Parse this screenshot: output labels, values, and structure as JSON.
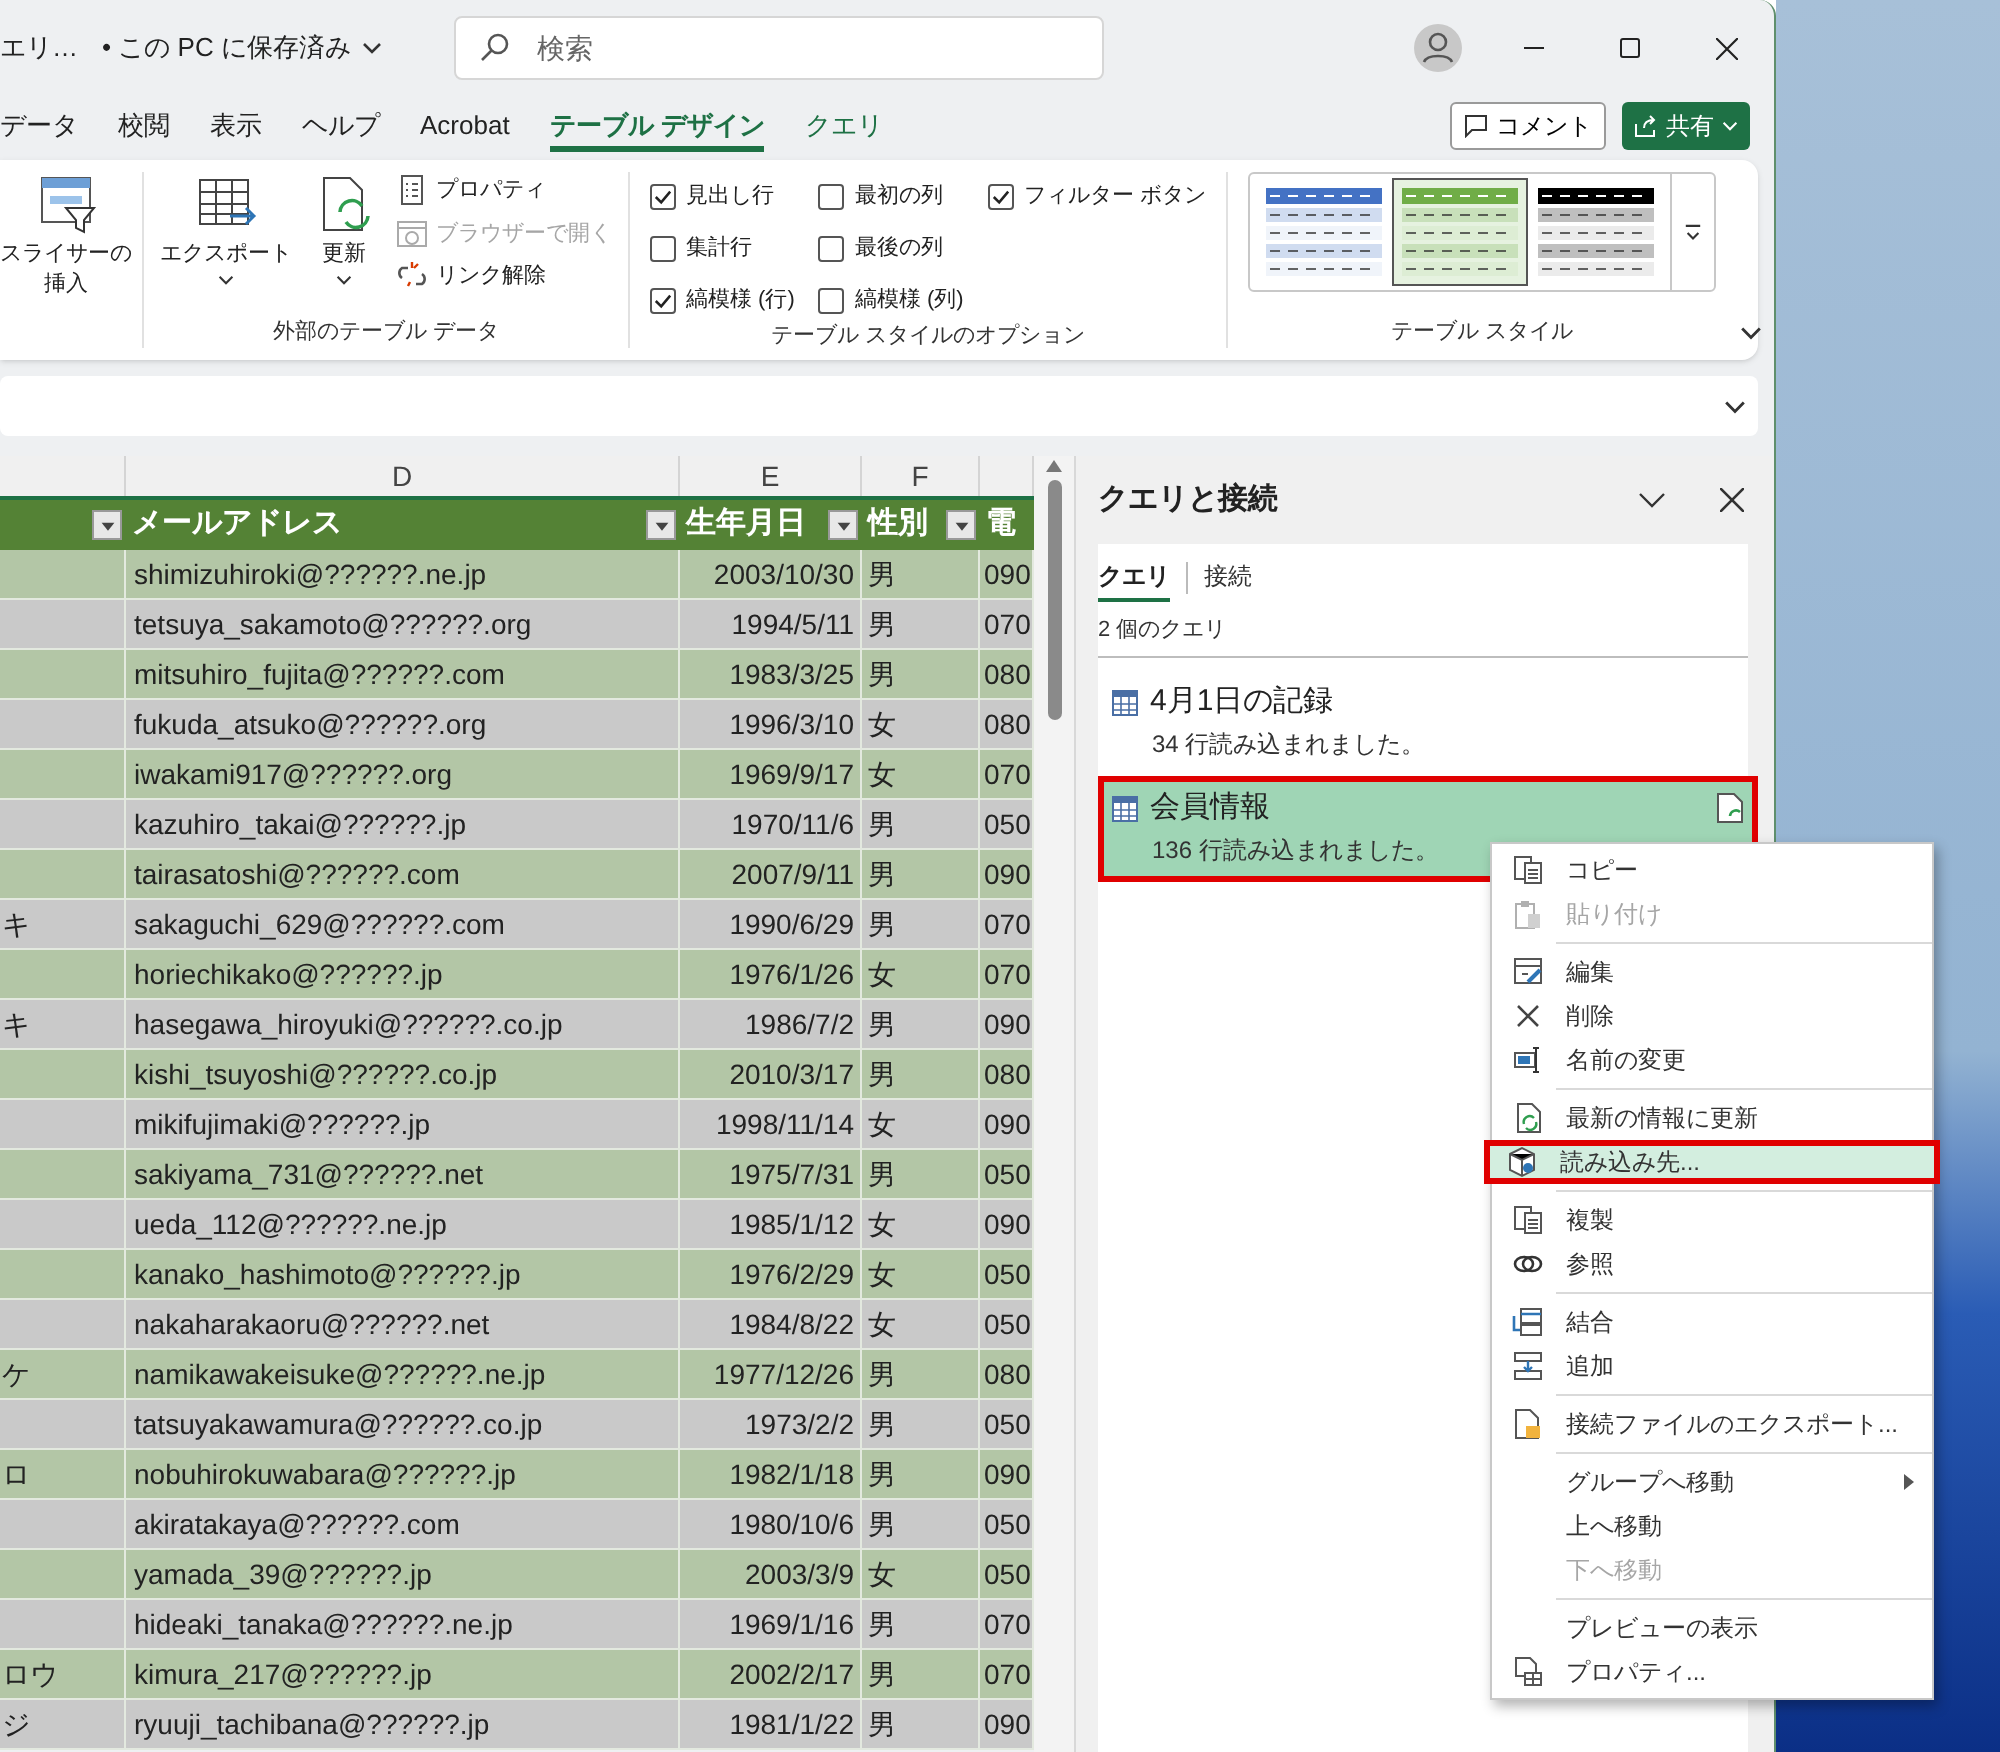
{
  "title_bar": {
    "file_name": "エリ…",
    "save_status": "• この PC に保存済み",
    "search": {
      "placeholder": "検索"
    }
  },
  "ribbon_tabs": [
    {
      "label": "データ",
      "kind": "normal",
      "selected": false
    },
    {
      "label": "校閲",
      "kind": "normal",
      "selected": false
    },
    {
      "label": "表示",
      "kind": "normal",
      "selected": false
    },
    {
      "label": "ヘルプ",
      "kind": "normal",
      "selected": false
    },
    {
      "label": "Acrobat",
      "kind": "normal",
      "selected": false
    },
    {
      "label": "テーブル デザイン",
      "kind": "contextual",
      "selected": true
    },
    {
      "label": "クエリ",
      "kind": "contextual",
      "selected": false
    }
  ],
  "comment_button": "コメント",
  "share_button": "共有",
  "ribbon": {
    "slicer_button": [
      "スライサーの",
      "挿入"
    ],
    "external_data": {
      "title": "外部のテーブル データ",
      "large_buttons": [
        "エクスポート",
        "更新"
      ],
      "small_buttons": [
        {
          "label": "プロパティ",
          "disabled": false
        },
        {
          "label": "ブラウザーで開く",
          "disabled": true
        },
        {
          "label": "リンク解除",
          "disabled": false
        }
      ]
    },
    "style_options": {
      "title": "テーブル スタイルのオプション",
      "checkboxes": [
        {
          "label": "見出し行",
          "checked": true
        },
        {
          "label": "集計行",
          "checked": false
        },
        {
          "label": "縞模様 (行)",
          "checked": true
        },
        {
          "label": "最初の列",
          "checked": false
        },
        {
          "label": "最後の列",
          "checked": false
        },
        {
          "label": "縞模様 (列)",
          "checked": false
        },
        {
          "label": "フィルター ボタン",
          "checked": true
        }
      ]
    },
    "table_styles": {
      "title": "テーブル スタイル",
      "styles": [
        {
          "color": "#4472c4",
          "selected": false
        },
        {
          "color": "#70ad47",
          "selected": true
        },
        {
          "color": "#000000",
          "selected": false
        }
      ]
    }
  },
  "sheet": {
    "columns": [
      {
        "filter_button": true
      },
      {
        "letter": "D",
        "header": "メールアドレス",
        "filter_button": true
      },
      {
        "letter": "E",
        "header": "生年月日",
        "filter_button": true
      },
      {
        "letter": "F",
        "header": "性別",
        "filter_button": true
      },
      {
        "header": "電",
        "filter_button": false
      }
    ],
    "rows": [
      {
        "email": "shimizuhiroki@??????.ne.jp",
        "birthdate": "2003/10/30",
        "gender": "男",
        "phone": "090"
      },
      {
        "email": "tetsuya_sakamoto@??????.org",
        "birthdate": "1994/5/11",
        "gender": "男",
        "phone": "070"
      },
      {
        "email": "mitsuhiro_fujita@??????.com",
        "birthdate": "1983/3/25",
        "gender": "男",
        "phone": "080"
      },
      {
        "email": "fukuda_atsuko@??????.org",
        "birthdate": "1996/3/10",
        "gender": "女",
        "phone": "080"
      },
      {
        "email": "iwakami917@??????.org",
        "birthdate": "1969/9/17",
        "gender": "女",
        "phone": "070"
      },
      {
        "email": "kazuhiro_takai@??????.jp",
        "birthdate": "1970/11/6",
        "gender": "男",
        "phone": "050"
      },
      {
        "email": "tairasatoshi@??????.com",
        "birthdate": "2007/9/11",
        "gender": "男",
        "phone": "090"
      },
      {
        "column_c": "キ",
        "email": "sakaguchi_629@??????.com",
        "birthdate": "1990/6/29",
        "gender": "男",
        "phone": "070"
      },
      {
        "email": "horiechikako@??????.jp",
        "birthdate": "1976/1/26",
        "gender": "女",
        "phone": "070"
      },
      {
        "column_c": "キ",
        "email": "hasegawa_hiroyuki@??????.co.jp",
        "birthdate": "1986/7/2",
        "gender": "男",
        "phone": "090"
      },
      {
        "email": "kishi_tsuyoshi@??????.co.jp",
        "birthdate": "2010/3/17",
        "gender": "男",
        "phone": "080"
      },
      {
        "email": "mikifujimaki@??????.jp",
        "birthdate": "1998/11/14",
        "gender": "女",
        "phone": "090"
      },
      {
        "email": "sakiyama_731@??????.net",
        "birthdate": "1975/7/31",
        "gender": "男",
        "phone": "050"
      },
      {
        "email": "ueda_112@??????.ne.jp",
        "birthdate": "1985/1/12",
        "gender": "女",
        "phone": "090"
      },
      {
        "email": "kanako_hashimoto@??????.jp",
        "birthdate": "1976/2/29",
        "gender": "女",
        "phone": "050"
      },
      {
        "email": "nakaharakaoru@??????.net",
        "birthdate": "1984/8/22",
        "gender": "女",
        "phone": "050"
      },
      {
        "column_c": "ケ",
        "email": "namikawakeisuke@??????.ne.jp",
        "birthdate": "1977/12/26",
        "gender": "男",
        "phone": "080"
      },
      {
        "email": "tatsuyakawamura@??????.co.jp",
        "birthdate": "1973/2/2",
        "gender": "男",
        "phone": "050"
      },
      {
        "column_c": "ロ",
        "email": "nobuhirokuwabara@??????.jp",
        "birthdate": "1982/1/18",
        "gender": "男",
        "phone": "090"
      },
      {
        "email": "akiratakaya@??????.com",
        "birthdate": "1980/10/6",
        "gender": "男",
        "phone": "050"
      },
      {
        "email": "yamada_39@??????.jp",
        "birthdate": "2003/3/9",
        "gender": "女",
        "phone": "050"
      },
      {
        "email": "hideaki_tanaka@??????.ne.jp",
        "birthdate": "1969/1/16",
        "gender": "男",
        "phone": "070"
      },
      {
        "column_c": "ロウ",
        "email": "kimura_217@??????.jp",
        "birthdate": "2002/2/17",
        "gender": "男",
        "phone": "070"
      },
      {
        "column_c": "ジ",
        "email": "ryuuji_tachibana@??????.jp",
        "birthdate": "1981/1/22",
        "gender": "男",
        "phone": "090"
      }
    ]
  },
  "query_pane": {
    "title": "クエリと接続",
    "tabs": [
      {
        "label": "クエリ",
        "selected": true
      },
      {
        "label": "接続",
        "selected": false
      }
    ],
    "count": "2 個のクエリ",
    "queries": [
      {
        "name": "4月1日の記録",
        "status": "34 行読み込まれました。",
        "selected": false,
        "highlighted": false
      },
      {
        "name": "会員情報",
        "status": "136 行読み込まれました。",
        "selected": true,
        "highlighted": true
      }
    ]
  },
  "context_menu": {
    "groups": [
      [
        {
          "label": "コピー",
          "disabled": false,
          "selected": false,
          "submenu": false
        },
        {
          "label": "貼り付け",
          "disabled": true,
          "selected": false,
          "submenu": false
        }
      ],
      [
        {
          "label": "編集",
          "disabled": false,
          "selected": false,
          "submenu": false
        },
        {
          "label": "削除",
          "disabled": false,
          "selected": false,
          "submenu": false
        },
        {
          "label": "名前の変更",
          "disabled": false,
          "selected": false,
          "submenu": false
        }
      ],
      [
        {
          "label": "最新の情報に更新",
          "disabled": false,
          "selected": false,
          "submenu": false
        },
        {
          "label": "読み込み先...",
          "disabled": false,
          "selected": true,
          "submenu": false
        }
      ],
      [
        {
          "label": "複製",
          "disabled": false,
          "selected": false,
          "submenu": false
        },
        {
          "label": "参照",
          "disabled": false,
          "selected": false,
          "submenu": false
        }
      ],
      [
        {
          "label": "結合",
          "disabled": false,
          "selected": false,
          "submenu": false
        },
        {
          "label": "追加",
          "disabled": false,
          "selected": false,
          "submenu": false
        }
      ],
      [
        {
          "label": "接続ファイルのエクスポート...",
          "disabled": false,
          "selected": false,
          "submenu": false
        }
      ],
      [
        {
          "label": "グループへ移動",
          "disabled": false,
          "selected": false,
          "submenu": true
        },
        {
          "label": "上へ移動",
          "disabled": false,
          "selected": false,
          "submenu": false
        },
        {
          "label": "下へ移動",
          "disabled": true,
          "selected": false,
          "submenu": false
        }
      ],
      [
        {
          "label": "プレビューの表示",
          "disabled": false,
          "selected": false,
          "submenu": false
        },
        {
          "label": "プロパティ...",
          "disabled": false,
          "selected": false,
          "submenu": false
        }
      ]
    ]
  }
}
